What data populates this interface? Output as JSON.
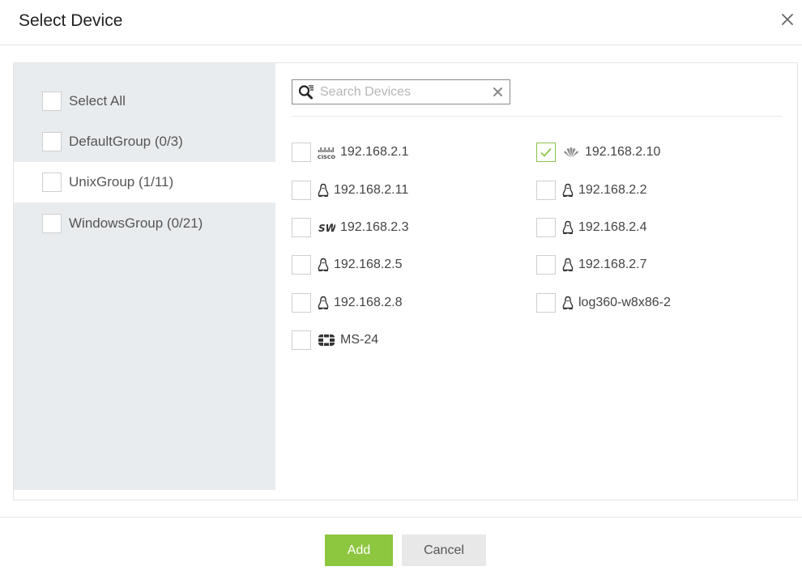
{
  "dialog": {
    "title": "Select Device",
    "close_label": "×"
  },
  "groups": [
    {
      "label": "Select All",
      "checked": false,
      "active": false
    },
    {
      "label": "DefaultGroup (0/3)",
      "checked": false,
      "active": false
    },
    {
      "label": "UnixGroup (1/11)",
      "checked": false,
      "active": true
    },
    {
      "label": "WindowsGroup (0/21)",
      "checked": false,
      "active": false
    }
  ],
  "search": {
    "placeholder": "Search Devices",
    "value": ""
  },
  "devices": [
    {
      "label": "192.168.2.1",
      "icon": "cisco-icon",
      "checked": false
    },
    {
      "label": "192.168.2.10",
      "icon": "huawei-icon",
      "checked": true
    },
    {
      "label": "192.168.2.11",
      "icon": "linux-icon",
      "checked": false
    },
    {
      "label": "192.168.2.2",
      "icon": "linux-icon",
      "checked": false
    },
    {
      "label": "192.168.2.3",
      "icon": "switch-icon",
      "checked": false
    },
    {
      "label": "192.168.2.4",
      "icon": "linux-icon",
      "checked": false
    },
    {
      "label": "192.168.2.5",
      "icon": "linux-icon",
      "checked": false
    },
    {
      "label": "192.168.2.7",
      "icon": "linux-icon",
      "checked": false
    },
    {
      "label": "192.168.2.8",
      "icon": "linux-icon",
      "checked": false
    },
    {
      "label": "log360-w8x86-2",
      "icon": "linux-icon",
      "checked": false
    },
    {
      "label": "MS-24",
      "icon": "fortinet-icon",
      "checked": false
    }
  ],
  "footer": {
    "add_label": "Add",
    "cancel_label": "Cancel"
  },
  "colors": {
    "accent": "#8dc63f",
    "left_panel_bg": "#e9ecee",
    "check_color": "#8bc34a"
  }
}
